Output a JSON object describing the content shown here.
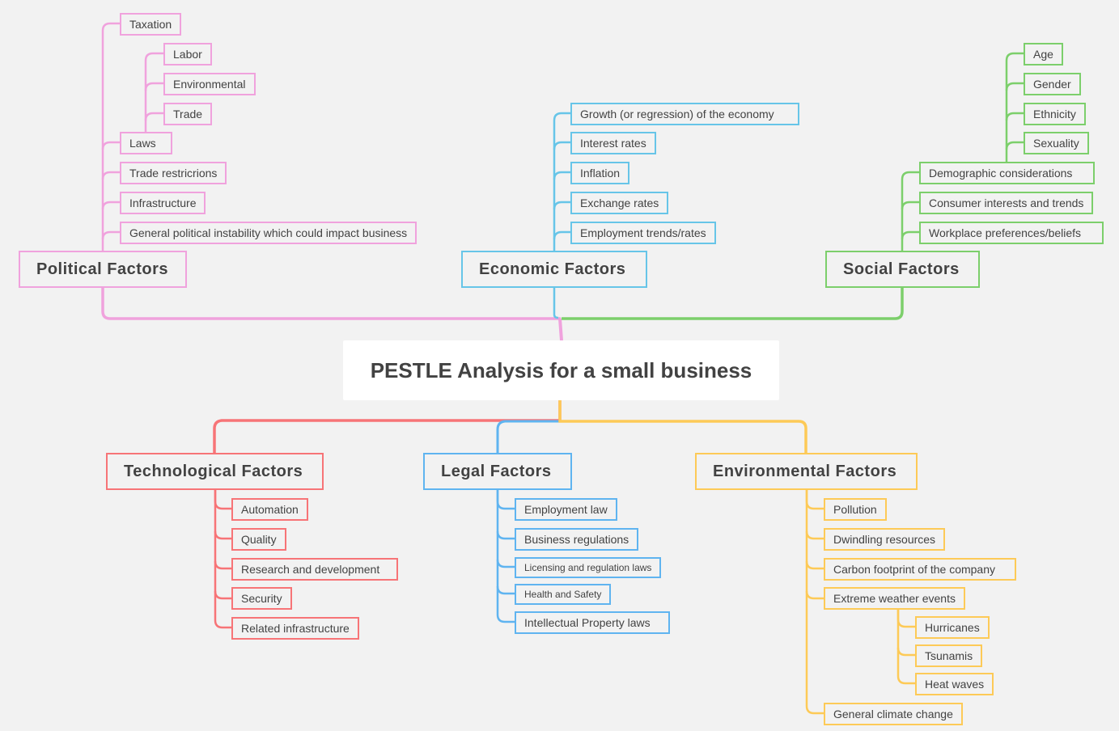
{
  "title": "PESTLE Analysis for a small business",
  "colors": {
    "political": "#f0a2dd",
    "economic": "#67c5e8",
    "social": "#7ccf6b",
    "technological": "#f77477",
    "legal": "#5fb4f0",
    "environmental": "#fdca57",
    "background": "#f2f2f2"
  },
  "political": {
    "label": "Political Factors",
    "items": [
      "Taxation",
      "Laws",
      "Trade restricrions",
      "Infrastructure",
      "General political instability which could impact business"
    ],
    "laws_children": [
      "Labor",
      "Environmental",
      "Trade"
    ]
  },
  "economic": {
    "label": "Economic Factors",
    "items": [
      "Growth (or regression) of the economy",
      "Interest rates",
      "Inflation",
      "Exchange rates",
      "Employment trends/rates"
    ]
  },
  "social": {
    "label": "Social Factors",
    "items": [
      "Demographic considerations",
      "Consumer interests and trends",
      "Workplace preferences/beliefs"
    ],
    "demographic_children": [
      "Age",
      "Gender",
      "Ethnicity",
      "Sexuality"
    ]
  },
  "technological": {
    "label": "Technological Factors",
    "items": [
      "Automation",
      "Quality",
      "Research and development",
      "Security",
      "Related infrastructure"
    ]
  },
  "legal": {
    "label": "Legal Factors",
    "items": [
      "Employment law",
      "Business regulations",
      "Licensing and regulation laws",
      "Health and Safety",
      "Intellectual Property laws"
    ]
  },
  "environmental": {
    "label": "Environmental Factors",
    "items": [
      "Pollution",
      "Dwindling resources",
      "Carbon footprint of the company",
      "Extreme weather events",
      "General climate change"
    ],
    "weather_children": [
      "Hurricanes",
      "Tsunamis",
      "Heat waves"
    ]
  }
}
